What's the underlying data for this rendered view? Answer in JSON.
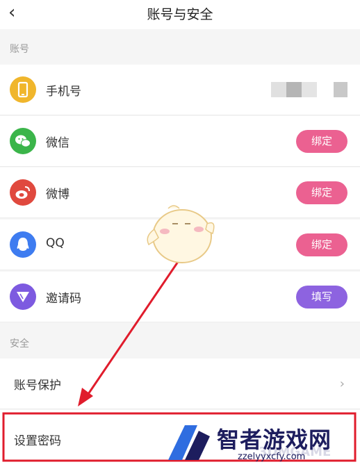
{
  "header": {
    "title": "账号与安全",
    "back_icon": "chevron-left-icon"
  },
  "sections": {
    "account_label": "账号",
    "security_label": "安全"
  },
  "account_rows": [
    {
      "label": "手机号",
      "icon": "phone-icon",
      "color": "#f0b62c"
    },
    {
      "label": "微信",
      "icon": "wechat-icon",
      "color": "#3bb54a",
      "action": "绑定"
    },
    {
      "label": "微博",
      "icon": "weibo-icon",
      "color": "#e0493e",
      "action": "绑定"
    },
    {
      "label": "QQ",
      "icon": "qq-icon",
      "color": "#3e7cf0",
      "action": "绑定"
    },
    {
      "label": "邀请码",
      "icon": "invite-code-icon",
      "color": "#7d5ae0",
      "action": "填写"
    }
  ],
  "security_rows": [
    {
      "label": "账号保护"
    },
    {
      "label": "设置密码"
    }
  ],
  "colors": {
    "bind_button": "#eb6191",
    "fill_button": "#8d63e0",
    "highlight": "#e01c2c"
  },
  "watermark": {
    "brand": "智者游戏网",
    "faint": "3DMGAME",
    "url": "zzelyyxcfy.com"
  }
}
